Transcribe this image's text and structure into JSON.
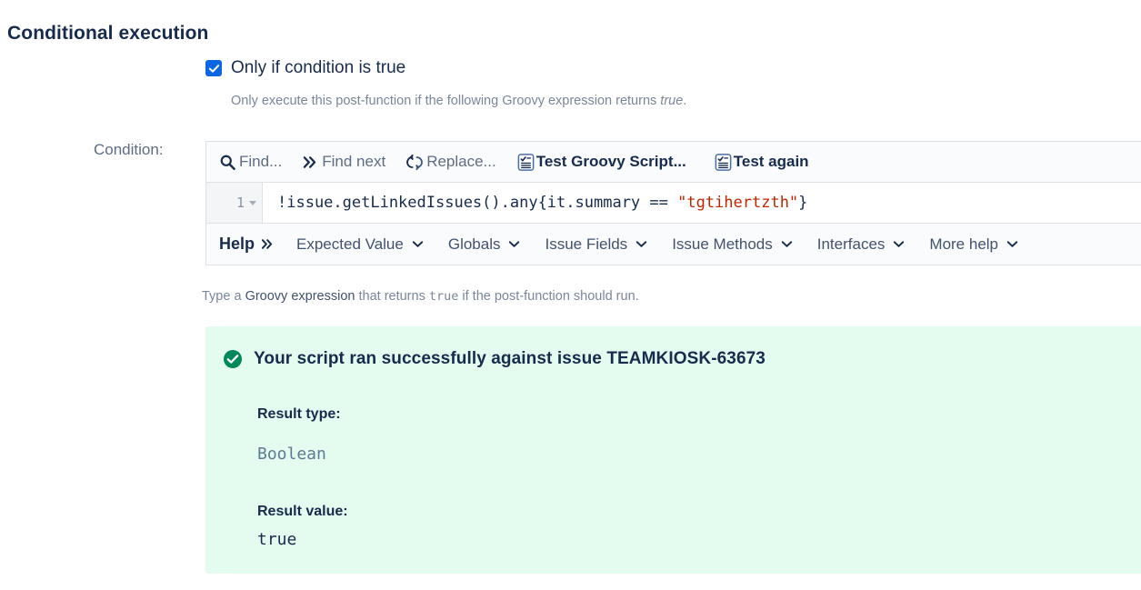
{
  "page": {
    "heading": "Conditional execution"
  },
  "condition_toggle": {
    "label": "Only if condition is true",
    "checked": true,
    "description_prefix": "Only execute this post-function if the following Groovy expression returns ",
    "description_emphasis": "true",
    "description_suffix": "."
  },
  "condition_field": {
    "label": "Condition:"
  },
  "editor": {
    "toolbar": [
      {
        "icon": "search-icon",
        "label": "Find..."
      },
      {
        "icon": "chevron-double-right-icon",
        "label": "Find next"
      },
      {
        "icon": "replace-swap-icon",
        "label": "Replace..."
      },
      {
        "icon": "test-script-icon",
        "label": "Test Groovy Script..."
      },
      {
        "icon": "test-script-icon",
        "label": "Test again"
      }
    ],
    "line_number": "1",
    "code": {
      "before_string": "!issue.getLinkedIssues().any{it.summary == ",
      "string_literal": "\"tgtihertzth\"",
      "after_string": "}"
    }
  },
  "help_bar": {
    "title": "Help",
    "items": [
      {
        "label": "Expected Value"
      },
      {
        "label": "Globals"
      },
      {
        "label": "Issue Fields"
      },
      {
        "label": "Issue Methods"
      },
      {
        "label": "Interfaces"
      },
      {
        "label": "More help"
      }
    ]
  },
  "hint": {
    "prefix": "Type a ",
    "link": "Groovy expression",
    "middle": " that returns ",
    "mono": "true",
    "suffix": " if the post-function should run."
  },
  "result_panel": {
    "status_icon": "check-circle-icon",
    "title": "Your script ran successfully against issue TEAMKIOSK-63673",
    "result_type_label": "Result type:",
    "result_type_value": "Boolean",
    "result_value_label": "Result value:",
    "result_value_value": "true"
  },
  "colors": {
    "checkbox_blue": "#0c66e4",
    "success_bg": "#e3fcef",
    "success_green": "#00875a",
    "string_red": "#bf2600",
    "text_primary": "#172b4d",
    "text_muted": "#7a869a"
  }
}
